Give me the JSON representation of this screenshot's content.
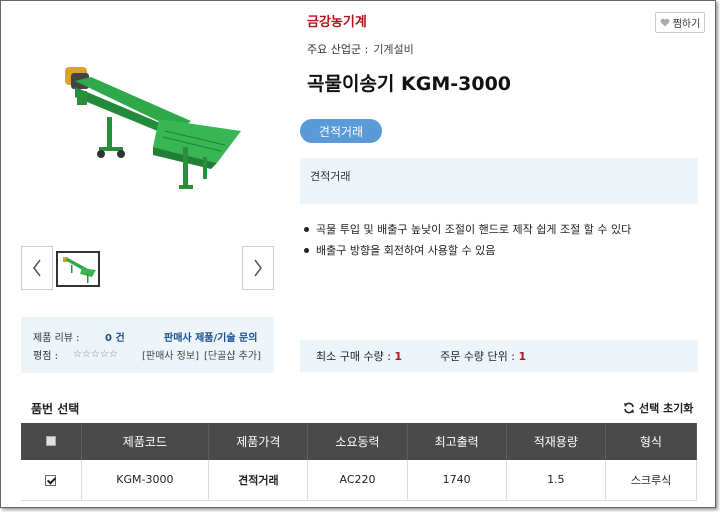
{
  "product": {
    "company": "금강농기계",
    "industry_label": "주요 산업군 :",
    "industry_value": "기계설비",
    "title": "곡물이송기 KGM-3000",
    "quote_badge": "견적거래",
    "price_text": "견적거래",
    "features": [
      "곡물 투입 및 배출구 높낮이 조절이 핸드로 제작 쉽게 조절 할 수 있다",
      "배출구 방향을 회전하여 사용할 수 있음"
    ]
  },
  "like_button": {
    "label": "찜하기",
    "icon": "heart-icon"
  },
  "review": {
    "label": "제품 리뷰 :",
    "count": "0 건",
    "inquiry_link": "판매사 제품/기술 문의",
    "rating_label": "평점 :",
    "stars": "☆☆☆☆☆",
    "seller_info": "[판매사 정보]",
    "add_shop": "[단골샵 추가]"
  },
  "order": {
    "min_label": "최소 구매 수량 :",
    "min_value": "1",
    "unit_label": "주문 수량 단위 :",
    "unit_value": "1"
  },
  "part_select": {
    "title": "품번 선택",
    "reset_label": "선택 초기화",
    "reset_icon": "refresh-icon"
  },
  "table": {
    "headers": [
      "제품코드",
      "제품가격",
      "소요동력",
      "최고출력",
      "적재용량",
      "형식"
    ],
    "rows": [
      [
        "KGM-3000",
        "견적거래",
        "AC220",
        "1740",
        "1.5",
        "스크루식"
      ]
    ]
  },
  "colors": {
    "brand_red": "#b2141e",
    "badge_blue": "#5a9ad8",
    "panel_bg": "#eef5fa",
    "table_header": "#4a4a4a",
    "machine_green": "#2fa84a"
  }
}
